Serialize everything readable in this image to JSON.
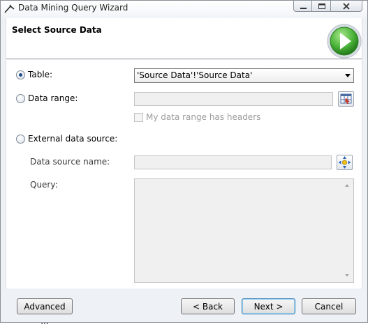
{
  "window": {
    "title": "Data Mining Query Wizard",
    "controls": [
      "minimize",
      "maximize",
      "close"
    ]
  },
  "header": {
    "title": "Select Source Data",
    "icon": "green-next-arrow-icon"
  },
  "source": {
    "table": {
      "label": "Table:",
      "selected": true,
      "value": "'Source Data'!'Source Data'"
    },
    "data_range": {
      "label": "Data range:",
      "selected": false,
      "value": "",
      "headers_checkbox_label": "My data range has headers",
      "headers_checked": false
    },
    "external": {
      "label": "External data source:",
      "selected": false,
      "data_source_name_label": "Data source name:",
      "data_source_name_value": "",
      "query_label": "Query:",
      "query_value": ""
    }
  },
  "footer": {
    "advanced_label": "Advanced ...",
    "back_label": "< Back",
    "next_label": "Next >",
    "cancel_label": "Cancel"
  },
  "colors": {
    "accent_green": "#3aa12a",
    "focus_blue": "#3c7fb1"
  }
}
